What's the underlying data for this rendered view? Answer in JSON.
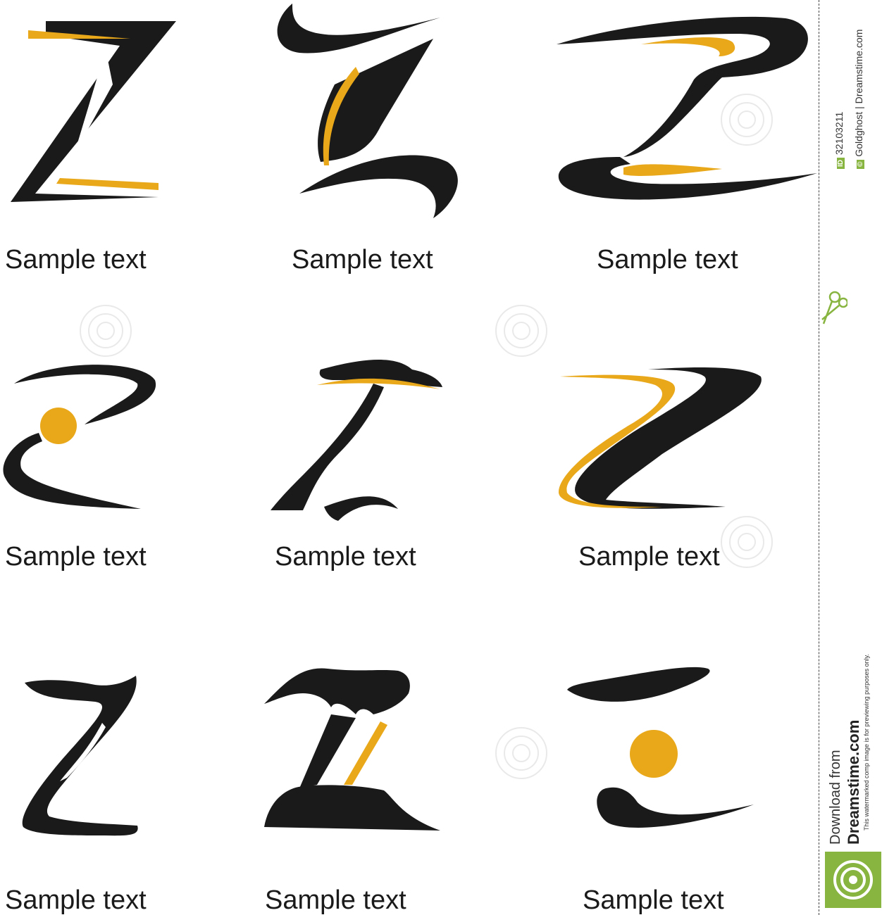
{
  "captions": [
    "Sample text",
    "Sample text",
    "Sample text",
    "Sample text",
    "Sample text",
    "Sample text",
    "Sample text",
    "Sample text",
    "Sample text"
  ],
  "colors": {
    "black": "#1a1a1a",
    "gold": "#e8a81a",
    "green": "#88b440"
  },
  "sidebar": {
    "id_badge": "ID",
    "id_number": "32103211",
    "copyright_badge": "©",
    "credit": "Goldghost | Dreamstime.com",
    "download_from": "Download from",
    "site": "Dreamstime.com",
    "disclaimer": "This watermarked comp image is for previewing purposes only."
  },
  "watermark_text": "dreamstime.com"
}
